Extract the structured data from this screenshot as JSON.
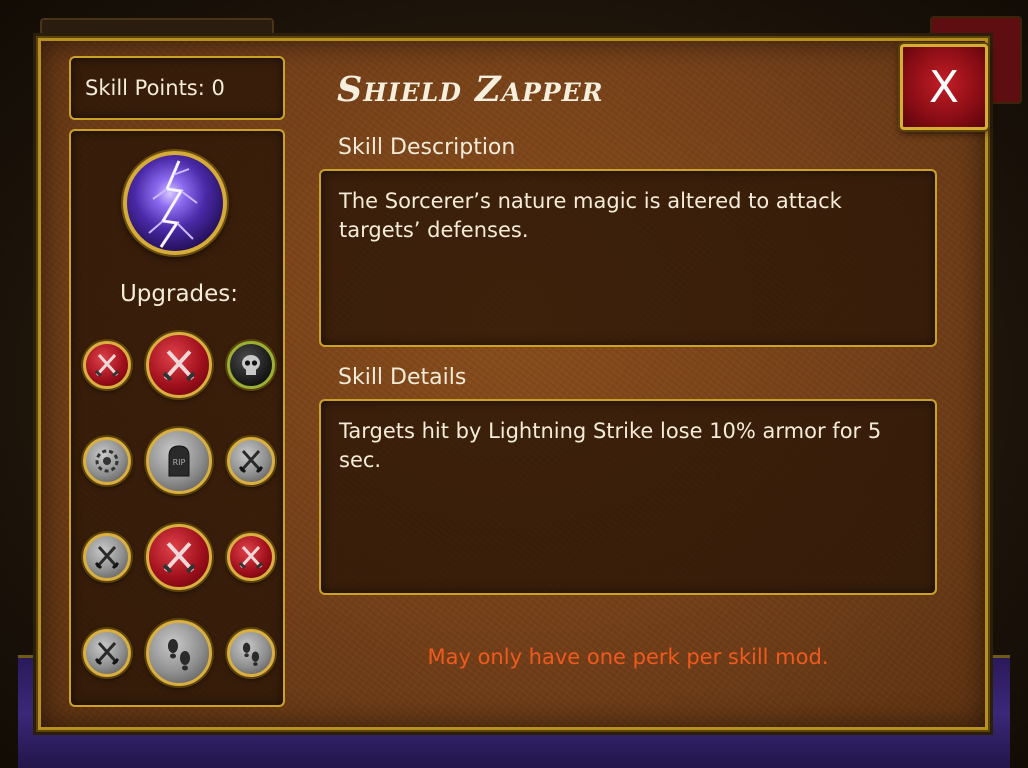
{
  "skill_points": {
    "label": "Skill Points: 0"
  },
  "skill": {
    "name": "Shield Zapper",
    "icon": "lightning-orb-icon"
  },
  "upgrades": {
    "label": "Upgrades:",
    "rows": [
      [
        {
          "icon": "crossed-swords-icon",
          "style": "red",
          "size": "small"
        },
        {
          "icon": "crossed-swords-icon",
          "style": "red",
          "size": "big"
        },
        {
          "icon": "skull-icon",
          "style": "dark",
          "size": "small"
        }
      ],
      [
        {
          "icon": "gear-ring-icon",
          "style": "gray",
          "size": "small"
        },
        {
          "icon": "tombstone-icon",
          "style": "gray",
          "size": "big",
          "text": "RIP"
        },
        {
          "icon": "crossed-swords-icon",
          "style": "gray",
          "size": "small"
        }
      ],
      [
        {
          "icon": "crossed-swords-icon",
          "style": "gray",
          "size": "small"
        },
        {
          "icon": "crossed-swords-icon",
          "style": "red",
          "size": "big"
        },
        {
          "icon": "crossed-swords-icon",
          "style": "red",
          "size": "small"
        }
      ],
      [
        {
          "icon": "crossed-swords-icon",
          "style": "gray",
          "size": "small"
        },
        {
          "icon": "footprints-icon",
          "style": "gray",
          "size": "big"
        },
        {
          "icon": "footprints-icon",
          "style": "gray",
          "size": "small"
        }
      ]
    ]
  },
  "description": {
    "label": "Skill Description",
    "text": "The Sorcerer’s nature magic is altered to attack targets’ defenses."
  },
  "details": {
    "label": "Skill Details",
    "text": "Targets hit by Lightning Strike lose 10% armor for 5 sec."
  },
  "note": "May only have one perk per skill mod.",
  "close": {
    "label": "X"
  },
  "colors": {
    "gold_border": "#c9a227",
    "note": "#f05a1e",
    "close_red": "#a1111d",
    "text": "#f4ecd8"
  }
}
